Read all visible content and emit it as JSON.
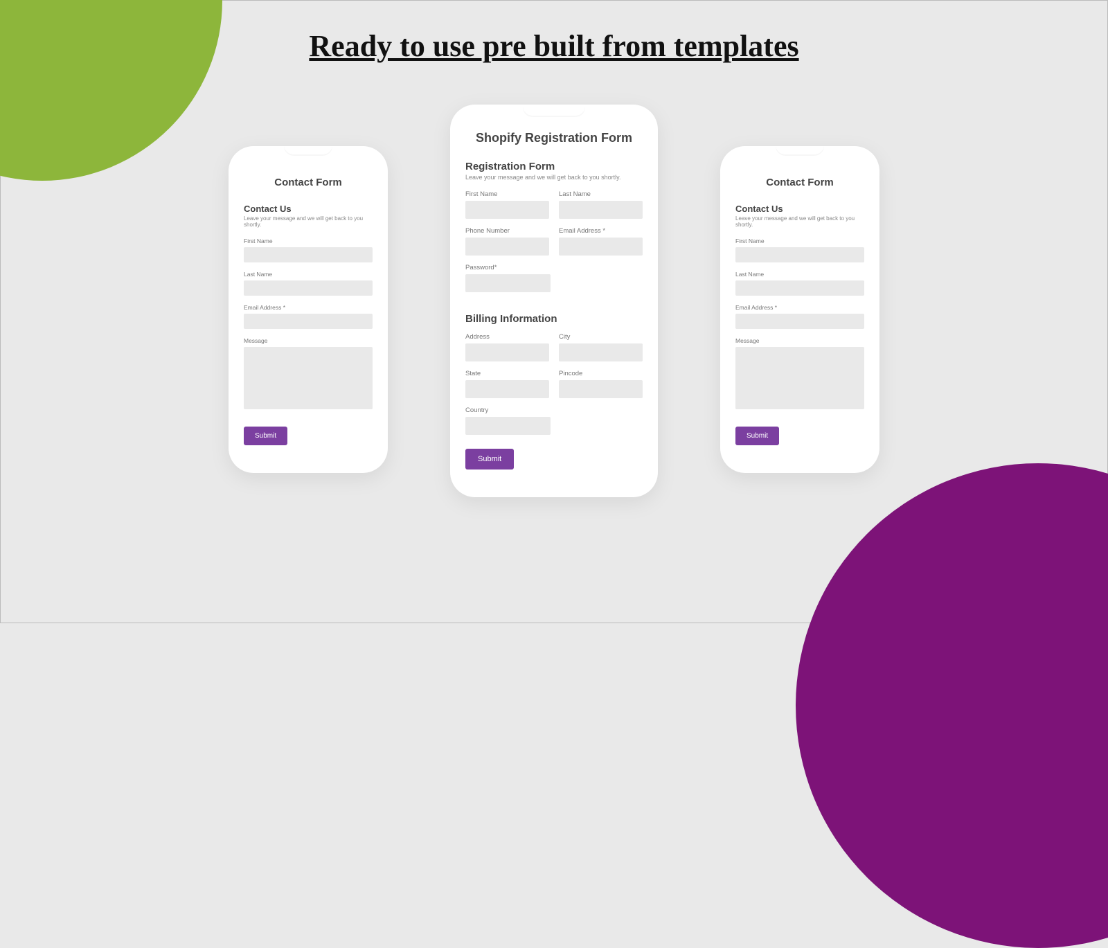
{
  "heading": "Ready to use pre built  from templates",
  "colors": {
    "accent": "#7b3fa0",
    "green": "#8db63b",
    "magenta": "#7d1378"
  },
  "left": {
    "title": "Contact Form",
    "section": "Contact Us",
    "sub": "Leave your message and we will get back to you shortly.",
    "fields": {
      "first": "First Name",
      "last": "Last Name",
      "email": "Email Address *",
      "message": "Message"
    },
    "submit": "Submit"
  },
  "center": {
    "title": "Shopify Registration Form",
    "section1": "Registration Form",
    "sub1": "Leave your message and we will get back to you shortly.",
    "reg": {
      "first": "First Name",
      "last": "Last Name",
      "phone": "Phone Number",
      "email": "Email Address *",
      "password": "Password*"
    },
    "section2": "Billing Information",
    "bill": {
      "address": "Address",
      "city": "City",
      "state": "State",
      "pincode": "Pincode",
      "country": "Country"
    },
    "submit": "Submit"
  },
  "right": {
    "title": "Contact Form",
    "section": "Contact Us",
    "sub": "Leave your message and we will get back to you shortly.",
    "fields": {
      "first": "First Name",
      "last": "Last Name",
      "email": "Email Address *",
      "message": "Message"
    },
    "submit": "Submit"
  }
}
